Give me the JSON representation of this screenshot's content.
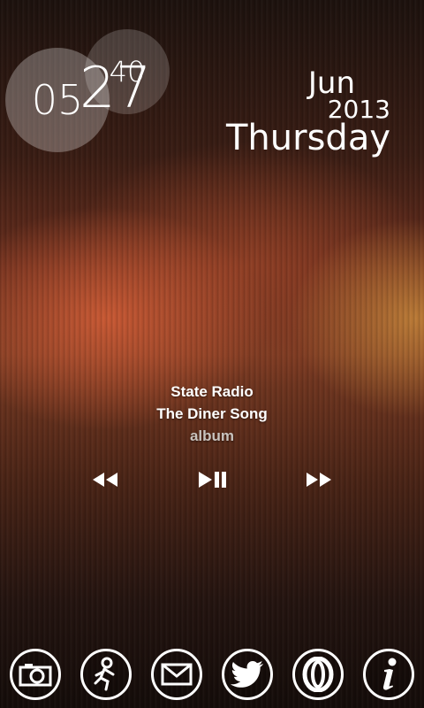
{
  "clock": {
    "hour": "05",
    "minute": "40"
  },
  "date": {
    "day": "27",
    "month": "Jun",
    "year": "2013",
    "weekday": "Thursday"
  },
  "music": {
    "artist": "State Radio",
    "title": "The Diner Song",
    "album": "album"
  },
  "controls": {
    "prev_icon": "rewind-icon",
    "play_icon": "play-pause-icon",
    "next_icon": "fast-forward-icon"
  },
  "dock": [
    "camera-icon",
    "aim-runner-icon",
    "mail-icon",
    "twitter-bird-icon",
    "opera-icon",
    "info-icon"
  ]
}
